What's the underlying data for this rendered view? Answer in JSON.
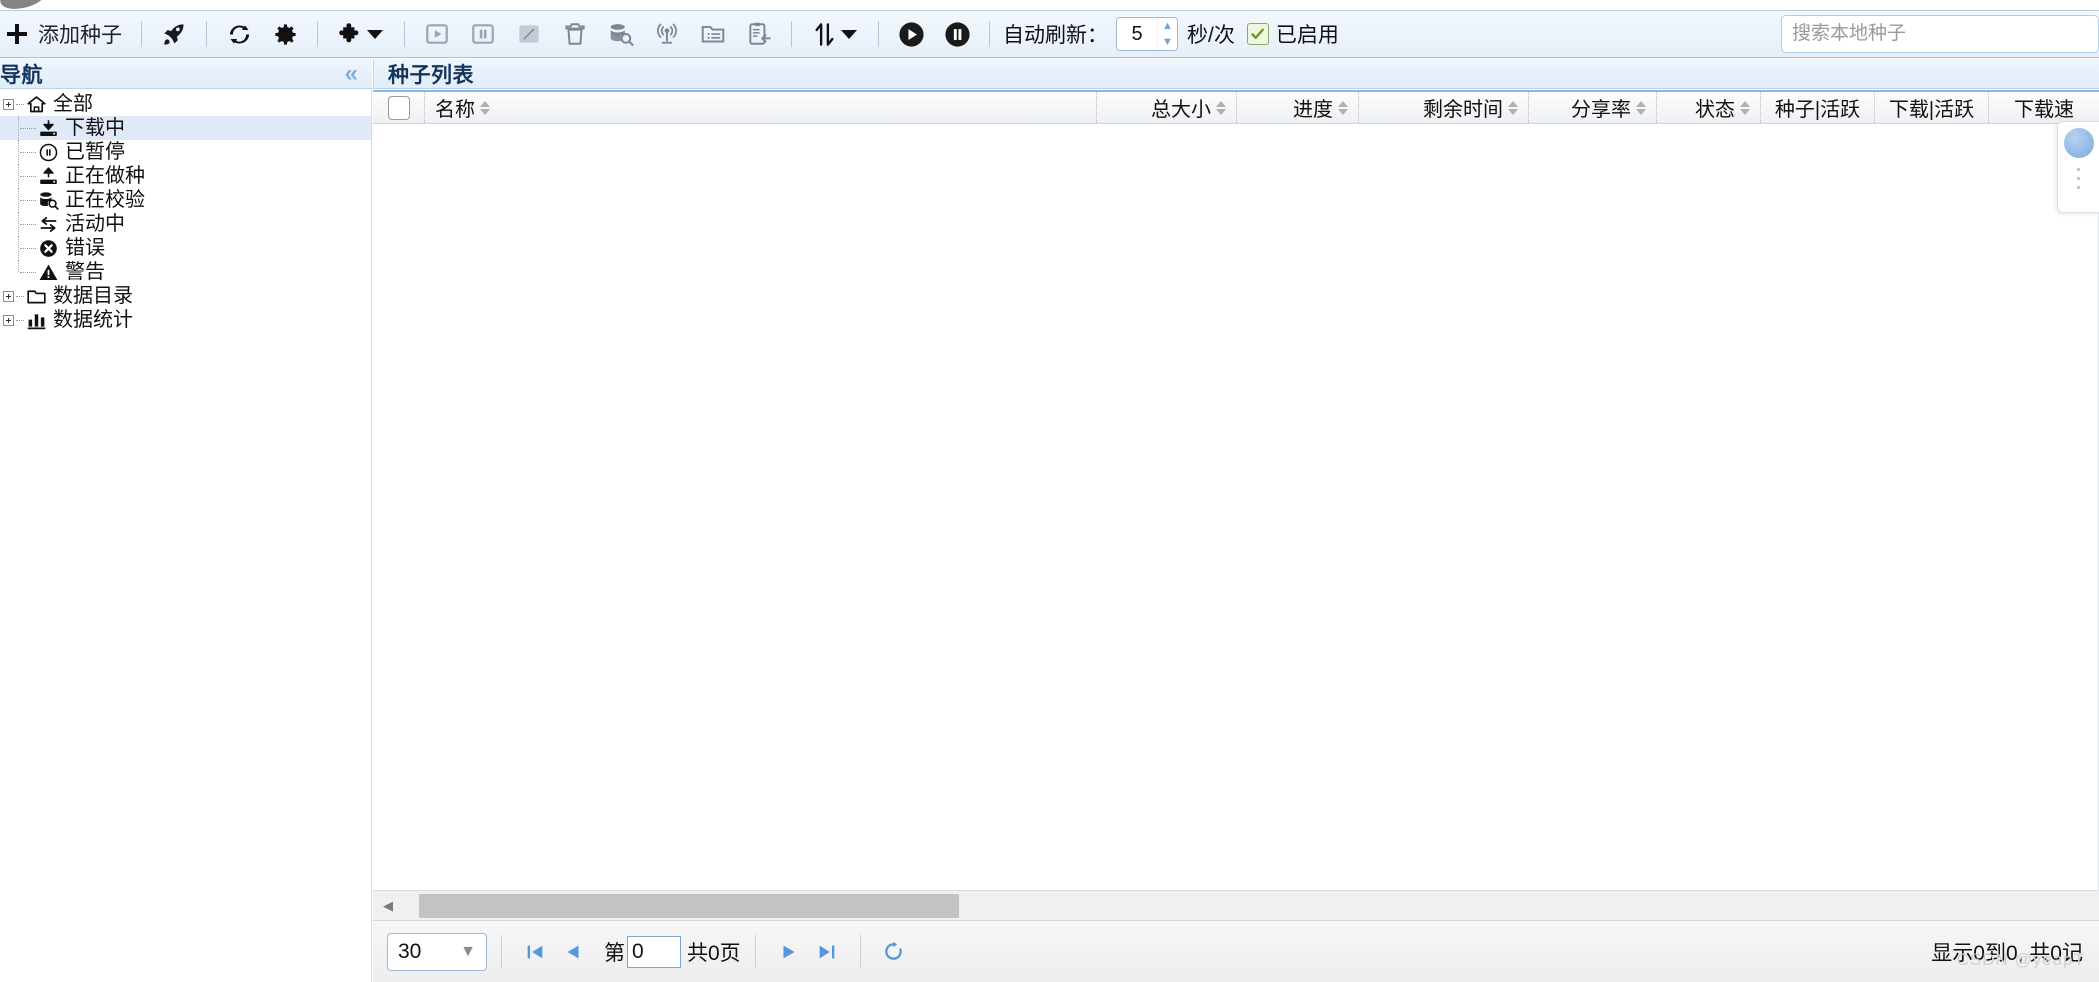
{
  "toolbar": {
    "add_torrent_label": "添加种子",
    "auto_refresh_label": "自动刷新：",
    "interval_value": "5",
    "interval_unit": "秒/次",
    "enabled_label": "已启用",
    "icons": [
      "plus-icon",
      "rocket-icon",
      "refresh-icon",
      "gear-icon",
      "puzzle-icon",
      "caret-down-icon",
      "start-icon",
      "pause-icon",
      "edit-icon",
      "delete-icon",
      "recheck-icon",
      "announce-icon",
      "folder-list-icon",
      "copy-icon",
      "priority-icon",
      "caret-down-icon",
      "resume-all-icon",
      "pause-all-icon"
    ]
  },
  "search": {
    "placeholder": "搜索本地种子",
    "value": ""
  },
  "sidebar": {
    "title": "导航",
    "collapse_label": "«",
    "items": [
      {
        "label": "全部",
        "icon": "home-icon",
        "level": 0,
        "expandable": true,
        "selected": false
      },
      {
        "label": "下载中",
        "icon": "download-icon",
        "level": 1,
        "expandable": false,
        "selected": true
      },
      {
        "label": "已暂停",
        "icon": "pause-circle-icon",
        "level": 1,
        "expandable": false,
        "selected": false
      },
      {
        "label": "正在做种",
        "icon": "upload-icon",
        "level": 1,
        "expandable": false,
        "selected": false
      },
      {
        "label": "正在校验",
        "icon": "recheck-icon",
        "level": 1,
        "expandable": false,
        "selected": false
      },
      {
        "label": "活动中",
        "icon": "exchange-icon",
        "level": 1,
        "expandable": false,
        "selected": false
      },
      {
        "label": "错误",
        "icon": "error-icon",
        "level": 1,
        "expandable": false,
        "selected": false
      },
      {
        "label": "警告",
        "icon": "warning-icon",
        "level": 1,
        "expandable": false,
        "selected": false
      },
      {
        "label": "数据目录",
        "icon": "folder-icon",
        "level": 0,
        "expandable": true,
        "selected": false
      },
      {
        "label": "数据统计",
        "icon": "chart-icon",
        "level": 0,
        "expandable": true,
        "selected": false
      }
    ]
  },
  "main": {
    "title": "种子列表",
    "columns": [
      {
        "label": "",
        "key": "check",
        "sortable": false
      },
      {
        "label": "名称",
        "key": "name",
        "sortable": true
      },
      {
        "label": "总大小",
        "key": "size",
        "sortable": true
      },
      {
        "label": "进度",
        "key": "progress",
        "sortable": true
      },
      {
        "label": "剩余时间",
        "key": "eta",
        "sortable": true
      },
      {
        "label": "分享率",
        "key": "ratio",
        "sortable": true
      },
      {
        "label": "状态",
        "key": "status",
        "sortable": true
      },
      {
        "label": "种子|活跃",
        "key": "seeds",
        "sortable": false
      },
      {
        "label": "下载|活跃",
        "key": "peers",
        "sortable": false
      },
      {
        "label": "下载速",
        "key": "dlspeed",
        "sortable": false
      }
    ],
    "rows": []
  },
  "pager": {
    "page_size": "30",
    "first_icon": "first-page-icon",
    "prev_icon": "prev-page-icon",
    "page_prefix": "第",
    "page_value": "0",
    "page_total": "共0页",
    "next_icon": "next-page-icon",
    "last_icon": "last-page-icon",
    "reload_icon": "reload-icon",
    "summary": "显示0到0, 共0记"
  },
  "watermark": "CSDN @yeapT"
}
